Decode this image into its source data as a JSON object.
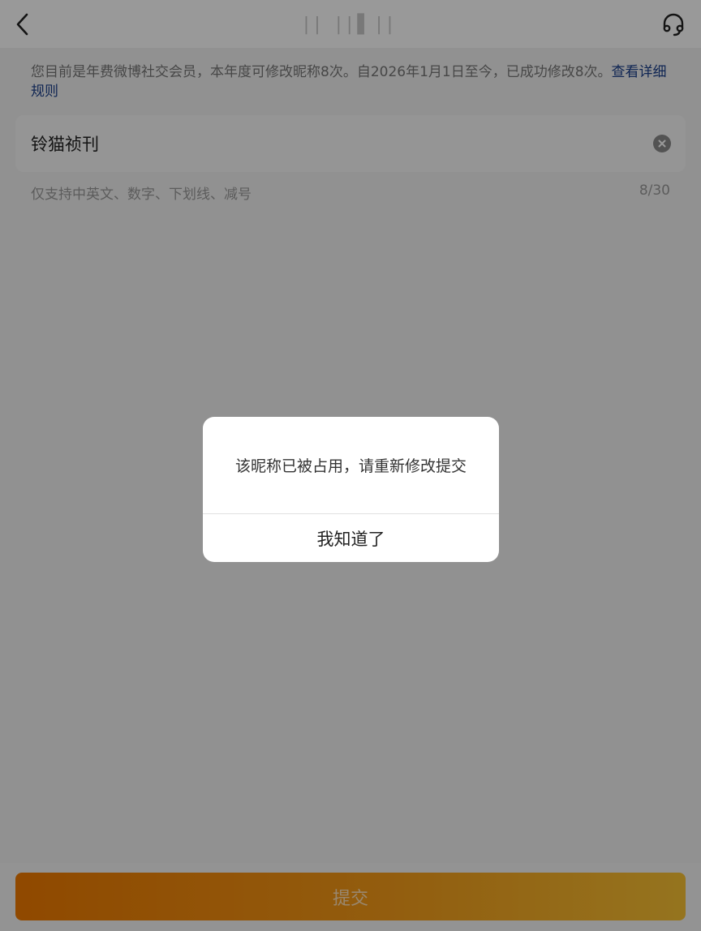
{
  "navbar": {
    "back_icon": "chevron-left-icon",
    "title": "|| ||▌||",
    "service_icon": "headset-icon"
  },
  "notice": {
    "text": "您目前是年费微博社交会员，本年度可修改昵称8次。自2026年1月1日至今，已成功修改8次。",
    "link_text": "查看详细规则",
    "link_color": "#1a3f8a"
  },
  "nickname_field": {
    "value": "铃猫祯刊",
    "clear_icon": "clear-circle-icon"
  },
  "hint": {
    "text": "仅支持中英文、数字、下划线、减号",
    "counter": "8/30"
  },
  "footer": {
    "submit_label": "提交",
    "accent_color": "#f07a00"
  },
  "dialog": {
    "message": "该昵称已被占用，请重新修改提交",
    "confirm_label": "我知道了"
  }
}
